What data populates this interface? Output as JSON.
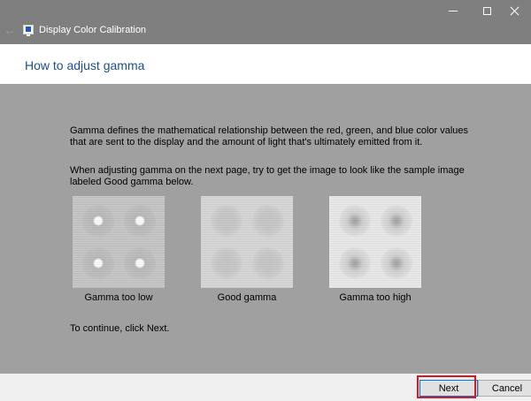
{
  "window": {
    "title": "Display Color Calibration",
    "back_icon": "back-arrow-icon",
    "app_icon": "monitor-icon",
    "controls": [
      "minimize-icon",
      "maximize-icon",
      "close-icon"
    ]
  },
  "header": {
    "title": "How to adjust gamma"
  },
  "main": {
    "paragraph1": "Gamma defines the mathematical relationship between the red, green, and blue color values that are sent to the display and the amount of light that's ultimately emitted from it.",
    "paragraph2": "When adjusting gamma on the next page, try to get the image to look like the sample image labeled Good gamma below.",
    "samples": [
      {
        "label": "Gamma too low"
      },
      {
        "label": "Good gamma"
      },
      {
        "label": "Gamma too high"
      }
    ],
    "continue_text": "To continue, click Next."
  },
  "footer": {
    "next_label": "Next",
    "cancel_label": "Cancel"
  },
  "colors": {
    "titlebar": "#7f7f7f",
    "content_bg": "#a0a0a0",
    "title_text": "#1d4f91",
    "highlight": "#e0141e"
  }
}
